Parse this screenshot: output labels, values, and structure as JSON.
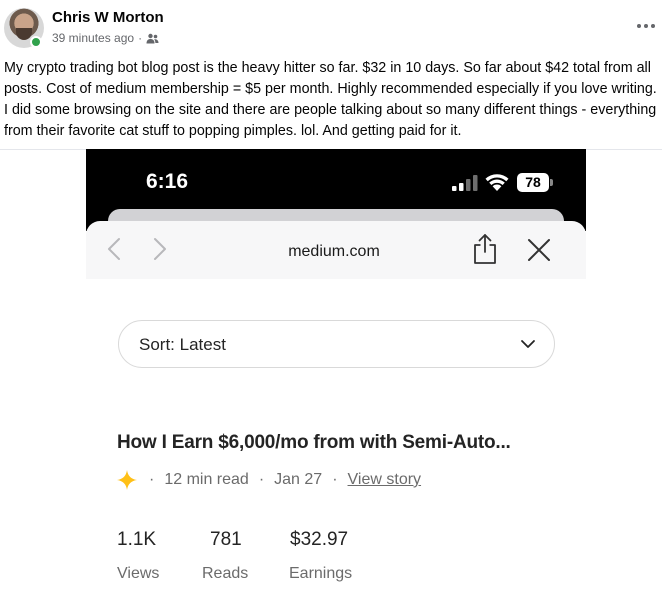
{
  "post": {
    "author": "Chris W Morton",
    "time_ago": "39 minutes ago",
    "separator": "·",
    "audience_icon": "friends-icon",
    "more_icon": "more-horizontal-icon",
    "text": "My crypto trading bot blog post is the heavy hitter so far.  $32 in 10 days. So far about $42 total from all posts. Cost of medium membership = $5 per month. Highly recommended especially if you love writing.  I did some browsing on the site and there are people talking about so many different things - everything from their favorite cat stuff to popping pimples.  lol.  And getting paid for it."
  },
  "phone": {
    "status_bar": {
      "time": "6:16",
      "battery": "78"
    },
    "browser": {
      "url": "medium.com"
    },
    "sort": {
      "label": "Sort: Latest"
    },
    "story": {
      "title": "How I Earn $6,000/mo from with Semi-Auto...",
      "read_time": "12 min read",
      "date": "Jan 27",
      "dot": "·",
      "view_link": "View story",
      "stats": [
        {
          "value": "1.1K",
          "label": "Views"
        },
        {
          "value": "781",
          "label": "Reads"
        },
        {
          "value": "$32.97",
          "label": "Earnings"
        }
      ]
    }
  },
  "colors": {
    "online": "#31a24c",
    "star": "#ffc017",
    "text_primary": "#242424",
    "text_secondary": "#6b6b6b"
  }
}
